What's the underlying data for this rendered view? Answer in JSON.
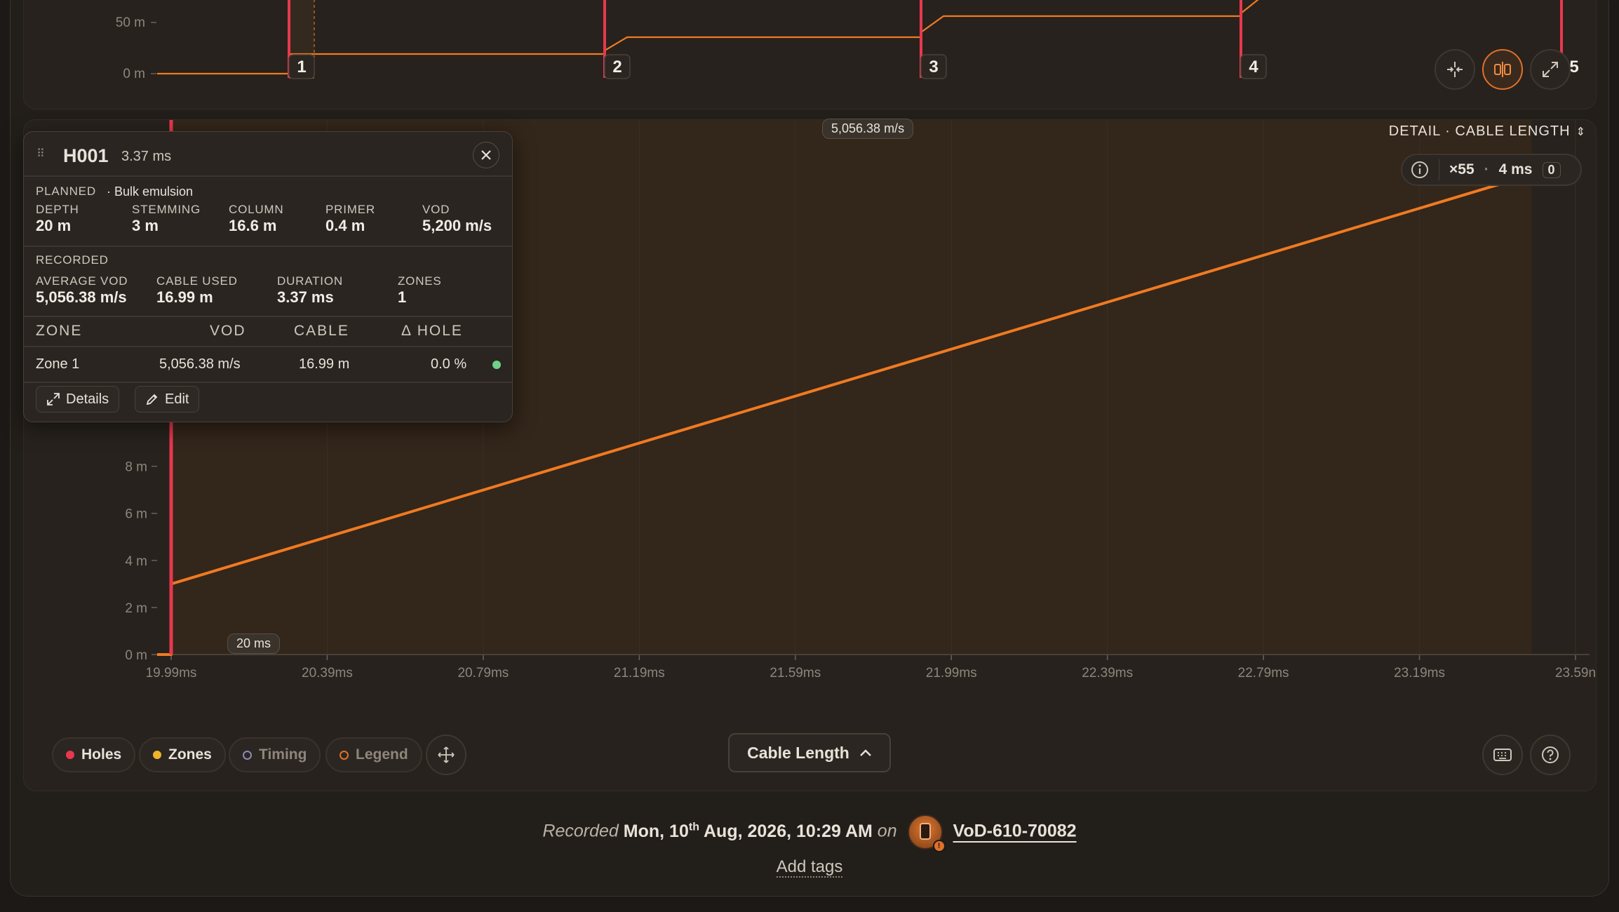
{
  "overview": {
    "y_ticks": [
      "50 m",
      "0 m"
    ],
    "markers": [
      "1",
      "2",
      "3",
      "4",
      "5"
    ]
  },
  "detail": {
    "mode_label": "DETAIL · CABLE LENGTH",
    "zoom_readout": "×55",
    "interval_readout": "4 ms",
    "count_readout": "0",
    "vod_chip": "5,056.38 m/s",
    "time_chip": "20 ms"
  },
  "chart_data": {
    "type": "line",
    "title": "",
    "xlabel": "",
    "ylabel": "",
    "x_tick_labels": [
      "19.99ms",
      "20.39ms",
      "20.79ms",
      "21.19ms",
      "21.59ms",
      "21.99ms",
      "22.39ms",
      "22.79ms",
      "23.19ms",
      "23.59n"
    ],
    "y_tick_labels": [
      "0 m",
      "2 m",
      "4 m",
      "6 m",
      "8 m"
    ],
    "xlim": [
      19.99,
      23.59
    ],
    "ylim": [
      0,
      22
    ],
    "series": [
      {
        "x": [
          19.2,
          19.99,
          19.99,
          23.37,
          23.59
        ],
        "y": [
          0,
          0,
          3.0,
          19.86,
          20.9
        ]
      }
    ],
    "hole_marker_x": 19.99
  },
  "popup": {
    "hole_id": "H001",
    "duration": "3.37 ms",
    "planned_label": "PLANNED",
    "explosive": "· Bulk emulsion",
    "planned": [
      {
        "label": "DEPTH",
        "value": "20 m"
      },
      {
        "label": "STEMMING",
        "value": "3 m"
      },
      {
        "label": "COLUMN",
        "value": "16.6 m"
      },
      {
        "label": "PRIMER",
        "value": "0.4 m"
      },
      {
        "label": "VOD",
        "value": "5,200 m/s"
      }
    ],
    "recorded_label": "RECORDED",
    "recorded": [
      {
        "label": "AVERAGE VOD",
        "value": "5,056.38 m/s"
      },
      {
        "label": "CABLE USED",
        "value": "16.99 m"
      },
      {
        "label": "DURATION",
        "value": "3.37 ms"
      },
      {
        "label": "ZONES",
        "value": "1"
      }
    ],
    "table_headers": [
      "ZONE",
      "VOD",
      "CABLE",
      "Δ HOLE"
    ],
    "rows": [
      {
        "zone": "Zone 1",
        "vod": "5,056.38 m/s",
        "cable": "16.99 m",
        "delta": "0.0 %",
        "status_color": "#6fd08a"
      }
    ],
    "details_label": "Details",
    "edit_label": "Edit"
  },
  "toolbar": {
    "holes_label": "Holes",
    "zones_label": "Zones",
    "timing_label": "Timing",
    "legend_label": "Legend",
    "view_select": "Cable Length"
  },
  "footer": {
    "recorded_word": "Recorded",
    "date_pre": "Mon, 10",
    "date_sup": "th",
    "date_post": " Aug, 2026, 10:29 AM",
    "on_word": "on",
    "device": "VoD-610-70082",
    "add_tags": "Add tags"
  },
  "colors": {
    "line": "#f07a22",
    "hole": "#e8384e",
    "zone": "#f0b429",
    "accent": "#e0702a"
  }
}
